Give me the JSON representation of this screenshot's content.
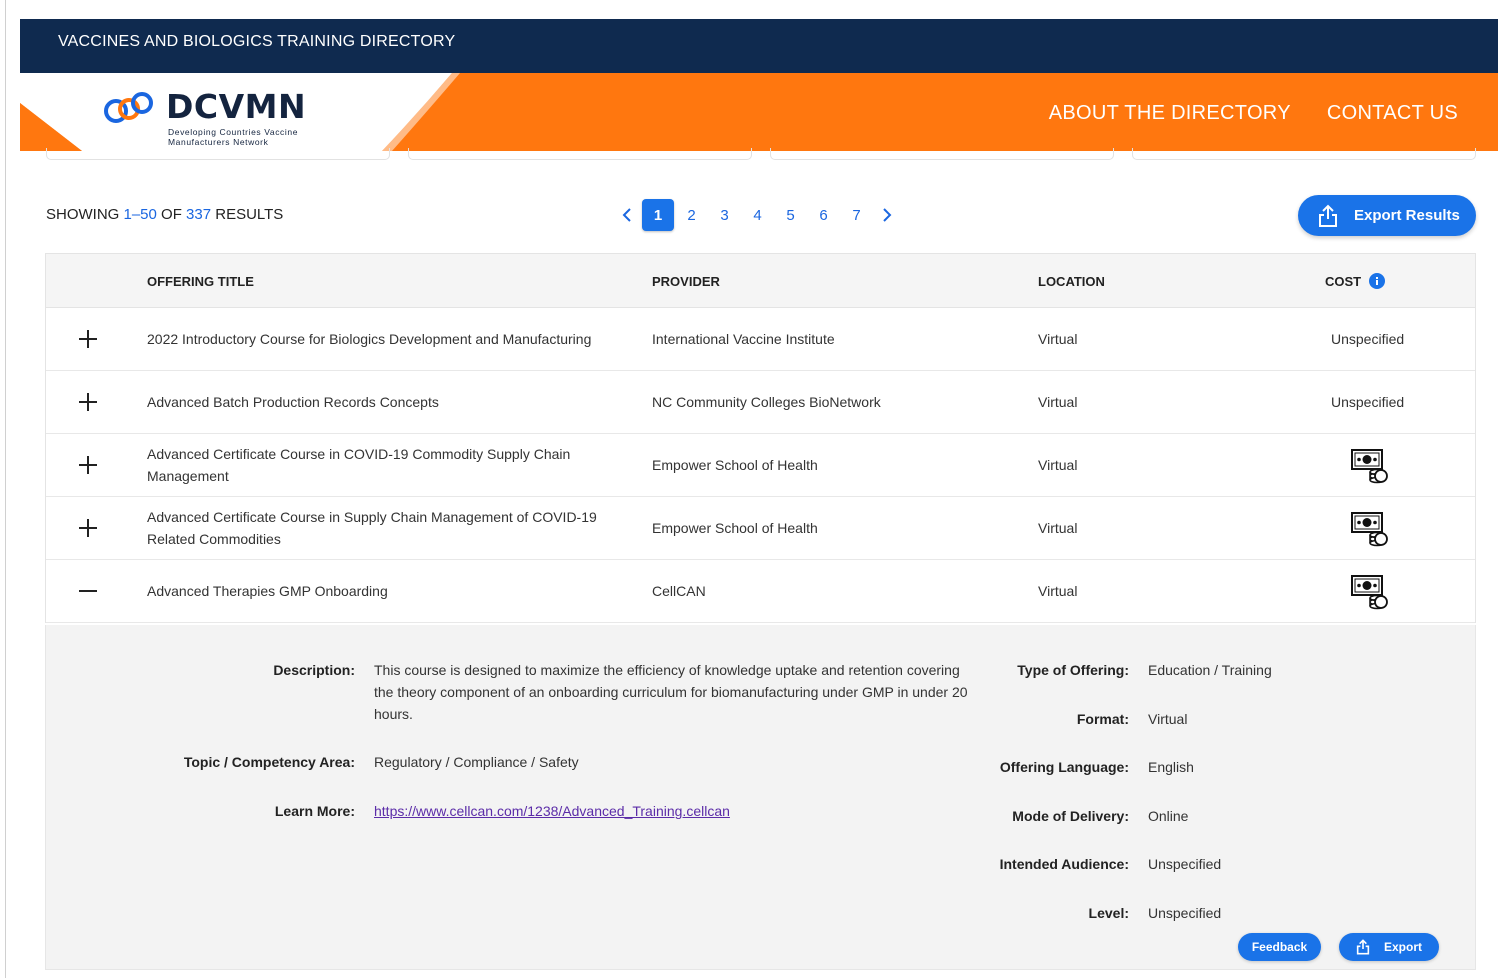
{
  "topbar": {
    "title": "VACCINES AND BIOLOGICS TRAINING DIRECTORY"
  },
  "logo": {
    "name": "DCVMN",
    "tagline_1": "Developing Countries Vaccine",
    "tagline_2": "Manufacturers Network"
  },
  "nav": {
    "about": "ABOUT THE DIRECTORY",
    "contact": "CONTACT US"
  },
  "results": {
    "prefix": "SHOWING ",
    "range": "1–50",
    "of": " OF ",
    "total": "337",
    "suffix": " RESULTS"
  },
  "pagination": {
    "pages": [
      "1",
      "2",
      "3",
      "4",
      "5",
      "6",
      "7"
    ],
    "current": "1"
  },
  "export": {
    "label": "Export Results"
  },
  "table": {
    "headers": {
      "title": "OFFERING TITLE",
      "provider": "PROVIDER",
      "location": "LOCATION",
      "cost": "COST"
    },
    "rows": [
      {
        "title": "2022 Introductory Course for Biologics Development and Manufacturing",
        "provider": "International Vaccine Institute",
        "location": "Virtual",
        "cost": "Unspecified",
        "cost_icon": "",
        "expanded": false
      },
      {
        "title": "Advanced Batch Production Records Concepts",
        "provider": "NC Community Colleges BioNetwork",
        "location": "Virtual",
        "cost": "Unspecified",
        "cost_icon": "",
        "expanded": false
      },
      {
        "title": "Advanced Certificate Course in COVID-19 Commodity Supply Chain Management",
        "provider": "Empower School of Health",
        "location": "Virtual",
        "cost": "",
        "cost_icon": "money-icon",
        "expanded": false
      },
      {
        "title": "Advanced Certificate Course in Supply Chain Management of COVID-19 Related Commodities",
        "provider": "Empower School of Health",
        "location": "Virtual",
        "cost": "",
        "cost_icon": "money-icon",
        "expanded": false
      },
      {
        "title": "Advanced Therapies GMP Onboarding",
        "provider": "CellCAN",
        "location": "Virtual",
        "cost": "",
        "cost_icon": "money-icon",
        "expanded": true
      }
    ]
  },
  "detail": {
    "description_label": "Description:",
    "description": "This course is designed to maximize the efficiency of knowledge uptake and retention covering the theory component of an onboarding curriculum for biomanufacturing under GMP in under 20 hours.",
    "topic_label": "Topic / Competency Area:",
    "topic": "Regulatory / Compliance / Safety",
    "learn_label": "Learn More:",
    "learn_url": "https://www.cellcan.com/1238/Advanced_Training.cellcan",
    "type_label": "Type of Offering:",
    "type": "Education / Training",
    "format_label": "Format:",
    "format": "Virtual",
    "language_label": "Offering Language:",
    "language": "English",
    "mode_label": "Mode of Delivery:",
    "mode": "Online",
    "audience_label": "Intended Audience:",
    "audience": "Unspecified",
    "level_label": "Level:",
    "level": "Unspecified",
    "feedback_label": "Feedback",
    "export_label": "Export"
  },
  "colors": {
    "navy": "#0f2a4f",
    "orange": "#ff770f",
    "accent_blue": "#1a73e8",
    "link_purple": "#5b2ca8"
  }
}
